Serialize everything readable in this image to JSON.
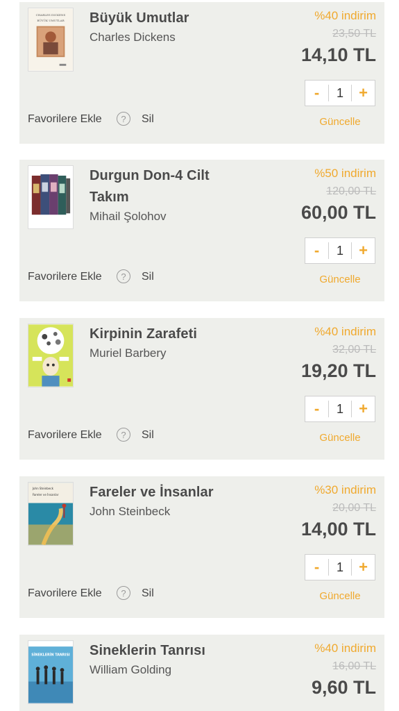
{
  "labels": {
    "favorites": "Favorilere Ekle",
    "help": "?",
    "delete": "Sil",
    "update": "Güncelle",
    "minus": "-",
    "plus": "+"
  },
  "items": [
    {
      "title": "Büyük Umutlar",
      "author": "Charles Dickens",
      "discount": "%40 indirim",
      "old_price": "23,50 TL",
      "price": "14,10 TL",
      "quantity": "1",
      "cover_top": "CHARLES DICKENS",
      "cover_title": "BÜYÜK UMUTLAR"
    },
    {
      "title": "Durgun Don-4 Cilt Takım",
      "author": "Mihail Şolohov",
      "discount": "%50 indirim",
      "old_price": "120,00 TL",
      "price": "60,00 TL",
      "quantity": "1"
    },
    {
      "title": "Kirpinin Zarafeti",
      "author": "Muriel Barbery",
      "discount": "%40 indirim",
      "old_price": "32,00 TL",
      "price": "19,20 TL",
      "quantity": "1"
    },
    {
      "title": "Fareler ve İnsanlar",
      "author": "John Steinbeck",
      "discount": "%30 indirim",
      "old_price": "20,00 TL",
      "price": "14,00 TL",
      "quantity": "1",
      "cover_top": "John Steinbeck",
      "cover_title": "Fareler ve İnsanlar"
    },
    {
      "title": "Sineklerin Tanrısı",
      "author": "William Golding",
      "discount": "%40 indirim",
      "old_price": "16,00 TL",
      "price": "9,60 TL",
      "quantity": "1",
      "cover_title": "SİNEKLERİN TANRISI"
    }
  ]
}
